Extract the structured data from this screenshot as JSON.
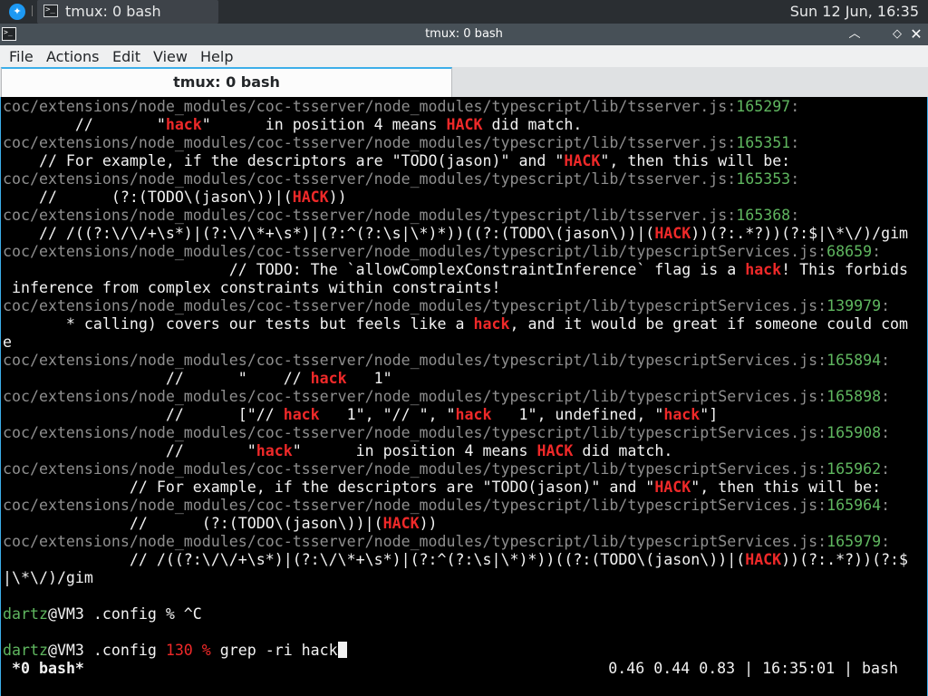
{
  "panel": {
    "task_title": "tmux: 0 bash",
    "clock": "Sun 12 Jun, 16:35"
  },
  "window": {
    "title": "tmux: 0 bash",
    "controls": [
      "minimize",
      "maximize",
      "close"
    ]
  },
  "menubar": [
    "File",
    "Actions",
    "Edit",
    "View",
    "Help"
  ],
  "tab": {
    "label": "tmux: 0 bash"
  },
  "terminal": {
    "lines": [
      [
        [
          "p",
          "coc/extensions/node_modules/coc-tsserver/node_modules/typescript/lib/tsserver.js"
        ],
        [
          "p",
          ":"
        ],
        [
          "n",
          "165297"
        ],
        [
          "p",
          ":"
        ]
      ],
      [
        [
          "t",
          "        //       \""
        ],
        [
          "h",
          "hack"
        ],
        [
          "t",
          "\"      in position 4 means "
        ],
        [
          "h",
          "HACK"
        ],
        [
          "t",
          " did match."
        ]
      ],
      [
        [
          "p",
          "coc/extensions/node_modules/coc-tsserver/node_modules/typescript/lib/tsserver.js"
        ],
        [
          "p",
          ":"
        ],
        [
          "n",
          "165351"
        ],
        [
          "p",
          ":"
        ]
      ],
      [
        [
          "t",
          "    // For example, if the descriptors are \"TODO(jason)\" and \""
        ],
        [
          "h",
          "HACK"
        ],
        [
          "t",
          "\", then this will be:"
        ]
      ],
      [
        [
          "p",
          "coc/extensions/node_modules/coc-tsserver/node_modules/typescript/lib/tsserver.js"
        ],
        [
          "p",
          ":"
        ],
        [
          "n",
          "165353"
        ],
        [
          "p",
          ":"
        ]
      ],
      [
        [
          "t",
          "    //      (?:(TODO\\(jason\\))|("
        ],
        [
          "h",
          "HACK"
        ],
        [
          "t",
          "))"
        ]
      ],
      [
        [
          "p",
          "coc/extensions/node_modules/coc-tsserver/node_modules/typescript/lib/tsserver.js"
        ],
        [
          "p",
          ":"
        ],
        [
          "n",
          "165368"
        ],
        [
          "p",
          ":"
        ]
      ],
      [
        [
          "t",
          "    // /((?:\\/\\/+\\s*)|(?:\\/\\*+\\s*)|(?:^(?:\\s|\\*)*))((?:(TODO\\(jason\\))|("
        ],
        [
          "h",
          "HACK"
        ],
        [
          "t",
          "))(?:.*?))(?:$|\\*\\/)/gim"
        ]
      ],
      [
        [
          "p",
          "coc/extensions/node_modules/coc-tsserver/node_modules/typescript/lib/typescriptServices.js"
        ],
        [
          "p",
          ":"
        ],
        [
          "n",
          "68659"
        ],
        [
          "p",
          ":"
        ]
      ],
      [
        [
          "t",
          "                         // TODO: The `allowComplexConstraintInference` flag is a "
        ],
        [
          "h",
          "hack"
        ],
        [
          "t",
          "! This forbids"
        ]
      ],
      [
        [
          "t",
          " inference from complex constraints within constraints!"
        ]
      ],
      [
        [
          "p",
          "coc/extensions/node_modules/coc-tsserver/node_modules/typescript/lib/typescriptServices.js"
        ],
        [
          "p",
          ":"
        ],
        [
          "n",
          "139979"
        ],
        [
          "p",
          ":"
        ]
      ],
      [
        [
          "t",
          "       * calling) covers our tests but feels like a "
        ],
        [
          "h",
          "hack"
        ],
        [
          "t",
          ", and it would be great if someone could com"
        ]
      ],
      [
        [
          "t",
          "e"
        ]
      ],
      [
        [
          "p",
          "coc/extensions/node_modules/coc-tsserver/node_modules/typescript/lib/typescriptServices.js"
        ],
        [
          "p",
          ":"
        ],
        [
          "n",
          "165894"
        ],
        [
          "p",
          ":"
        ]
      ],
      [
        [
          "t",
          "                  //      \"    // "
        ],
        [
          "h",
          "hack"
        ],
        [
          "t",
          "   1\""
        ]
      ],
      [
        [
          "p",
          "coc/extensions/node_modules/coc-tsserver/node_modules/typescript/lib/typescriptServices.js"
        ],
        [
          "p",
          ":"
        ],
        [
          "n",
          "165898"
        ],
        [
          "p",
          ":"
        ]
      ],
      [
        [
          "t",
          "                  //      [\"// "
        ],
        [
          "h",
          "hack"
        ],
        [
          "t",
          "   1\", \"// \", \""
        ],
        [
          "h",
          "hack"
        ],
        [
          "t",
          "   1\", undefined, \""
        ],
        [
          "h",
          "hack"
        ],
        [
          "t",
          "\"]"
        ]
      ],
      [
        [
          "p",
          "coc/extensions/node_modules/coc-tsserver/node_modules/typescript/lib/typescriptServices.js"
        ],
        [
          "p",
          ":"
        ],
        [
          "n",
          "165908"
        ],
        [
          "p",
          ":"
        ]
      ],
      [
        [
          "t",
          "                  //       \""
        ],
        [
          "h",
          "hack"
        ],
        [
          "t",
          "\"      in position 4 means "
        ],
        [
          "h",
          "HACK"
        ],
        [
          "t",
          " did match."
        ]
      ],
      [
        [
          "p",
          "coc/extensions/node_modules/coc-tsserver/node_modules/typescript/lib/typescriptServices.js"
        ],
        [
          "p",
          ":"
        ],
        [
          "n",
          "165962"
        ],
        [
          "p",
          ":"
        ]
      ],
      [
        [
          "t",
          "              // For example, if the descriptors are \"TODO(jason)\" and \""
        ],
        [
          "h",
          "HACK"
        ],
        [
          "t",
          "\", then this will be:"
        ]
      ],
      [
        [
          "p",
          "coc/extensions/node_modules/coc-tsserver/node_modules/typescript/lib/typescriptServices.js"
        ],
        [
          "p",
          ":"
        ],
        [
          "n",
          "165964"
        ],
        [
          "p",
          ":"
        ]
      ],
      [
        [
          "t",
          "              //      (?:(TODO\\(jason\\))|("
        ],
        [
          "h",
          "HACK"
        ],
        [
          "t",
          "))"
        ]
      ],
      [
        [
          "p",
          "coc/extensions/node_modules/coc-tsserver/node_modules/typescript/lib/typescriptServices.js"
        ],
        [
          "p",
          ":"
        ],
        [
          "n",
          "165979"
        ],
        [
          "p",
          ":"
        ]
      ],
      [
        [
          "t",
          "              // /((?:\\/\\/+\\s*)|(?:\\/\\*+\\s*)|(?:^(?:\\s|\\*)*))((?:(TODO\\(jason\\))|("
        ],
        [
          "h",
          "HACK"
        ],
        [
          "t",
          "))(?:.*?))(?:$"
        ]
      ],
      [
        [
          "t",
          "|\\*\\/)/gim"
        ]
      ],
      [
        [
          "t",
          ""
        ]
      ],
      [
        [
          "u",
          "dartz"
        ],
        [
          "t",
          "@VM3 .config % ^C"
        ]
      ],
      [
        [
          "t",
          ""
        ]
      ],
      [
        [
          "u",
          "dartz"
        ],
        [
          "t",
          "@VM3 .config "
        ],
        [
          "c",
          "130 %"
        ],
        [
          "t",
          " grep -ri hack"
        ],
        [
          "cur",
          ""
        ]
      ]
    ],
    "status_left": "*0 bash*",
    "status_right": "0.46 0.44 0.83 | 16:35:01 | bash"
  },
  "colors": {
    "accent": "#3daee9",
    "match": "#ef2929",
    "line_number": "#5fb65f",
    "path": "#8e8e8e"
  }
}
